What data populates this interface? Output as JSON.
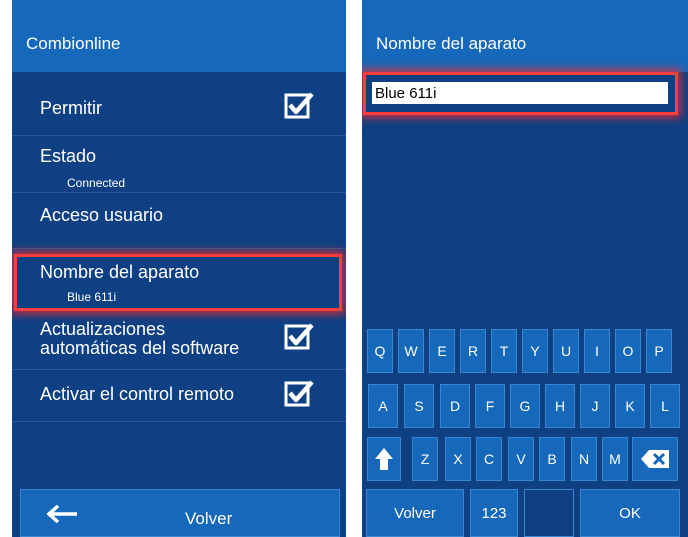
{
  "left_panel": {
    "title": "Combionline",
    "items": [
      {
        "label": "Permitir",
        "checked": true
      },
      {
        "label": "Estado",
        "sub": "Connected"
      },
      {
        "label": "Acceso usuario"
      },
      {
        "label": "Nombre del aparato",
        "sub": "Blue 611i",
        "highlighted": true
      },
      {
        "label_line1": "Actualizaciones",
        "label_line2": "automáticas del software",
        "checked": true
      },
      {
        "label": "Activar el control remoto",
        "checked": true
      }
    ],
    "back_label": "Volver",
    "back_icon": "arrow-left-icon"
  },
  "right_panel": {
    "title": "Nombre del aparato",
    "input_value": "Blue 611i",
    "keyboard": {
      "row1": [
        "Q",
        "W",
        "E",
        "R",
        "T",
        "Y",
        "U",
        "I",
        "O",
        "P"
      ],
      "row2": [
        "A",
        "S",
        "D",
        "F",
        "G",
        "H",
        "J",
        "K",
        "L"
      ],
      "row3": [
        "Z",
        "X",
        "C",
        "V",
        "B",
        "N",
        "M"
      ],
      "shift_icon": "shift-arrow-icon",
      "backspace_icon": "backspace-icon",
      "bottom": {
        "back": "Volver",
        "numbers": "123",
        "ok": "OK"
      }
    }
  },
  "colors": {
    "panel_bg": "#0e4083",
    "bar_bg": "#1668bb",
    "highlight": "#ff3b3b"
  }
}
